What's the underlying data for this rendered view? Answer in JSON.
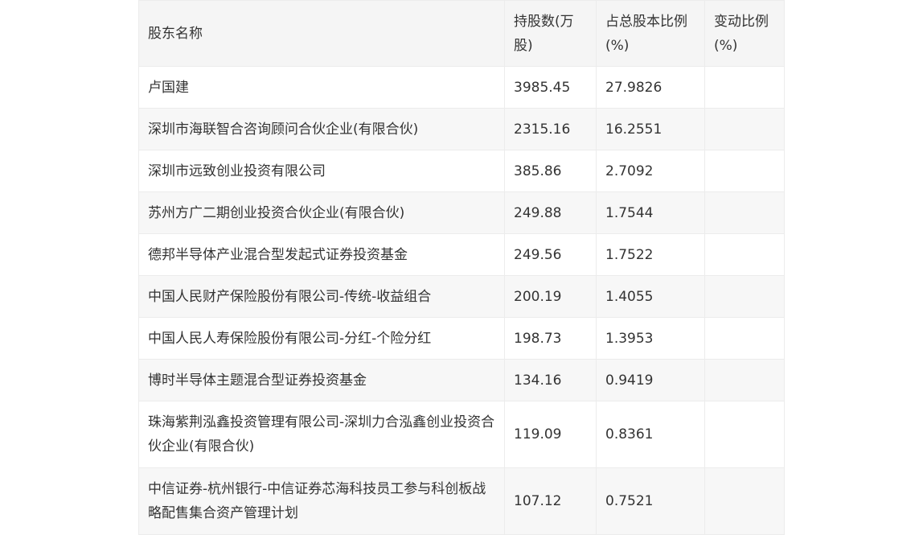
{
  "table": {
    "headers": [
      "股东名称",
      "持股数(万股)",
      "占总股本比例(%)",
      "变动比例(%)"
    ],
    "rows": [
      {
        "name": "卢国建",
        "shares": "3985.45",
        "ratio": "27.9826",
        "change": ""
      },
      {
        "name": "深圳市海联智合咨询顾问合伙企业(有限合伙)",
        "shares": "2315.16",
        "ratio": "16.2551",
        "change": ""
      },
      {
        "name": "深圳市远致创业投资有限公司",
        "shares": "385.86",
        "ratio": "2.7092",
        "change": ""
      },
      {
        "name": "苏州方广二期创业投资合伙企业(有限合伙)",
        "shares": "249.88",
        "ratio": "1.7544",
        "change": ""
      },
      {
        "name": "德邦半导体产业混合型发起式证券投资基金",
        "shares": "249.56",
        "ratio": "1.7522",
        "change": ""
      },
      {
        "name": "中国人民财产保险股份有限公司-传统-收益组合",
        "shares": "200.19",
        "ratio": "1.4055",
        "change": ""
      },
      {
        "name": "中国人民人寿保险股份有限公司-分红-个险分红",
        "shares": "198.73",
        "ratio": "1.3953",
        "change": ""
      },
      {
        "name": "博时半导体主题混合型证券投资基金",
        "shares": "134.16",
        "ratio": "0.9419",
        "change": ""
      },
      {
        "name": "珠海紫荆泓鑫投资管理有限公司-深圳力合泓鑫创业投资合伙企业(有限合伙)",
        "shares": "119.09",
        "ratio": "0.8361",
        "change": ""
      },
      {
        "name": "中信证券-杭州银行-中信证券芯海科技员工参与科创板战略配售集合资产管理计划",
        "shares": "107.12",
        "ratio": "0.7521",
        "change": ""
      }
    ]
  }
}
